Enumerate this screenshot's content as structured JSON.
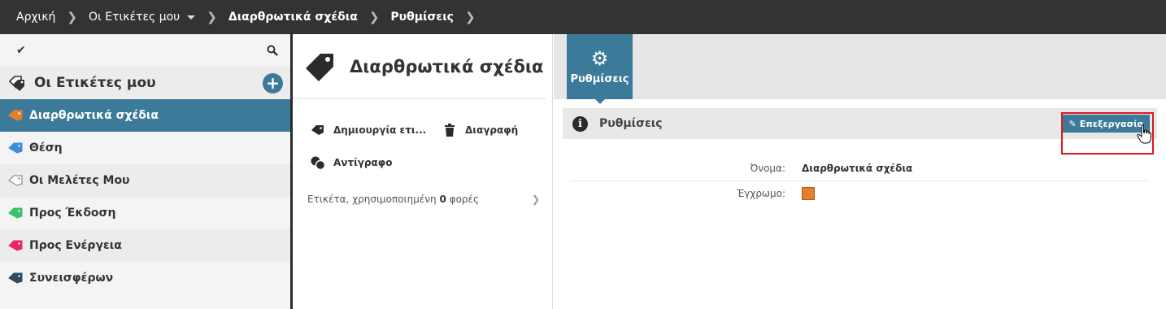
{
  "breadcrumb": {
    "items": [
      {
        "label": "Αρχική"
      },
      {
        "label": "Οι Ετικέτες μου"
      },
      {
        "label": "Διαρθρωτικά σχέδια"
      },
      {
        "label": "Ρυθμίσεις"
      }
    ]
  },
  "sidebar": {
    "title": "Οι Ετικέτες μου",
    "items": [
      {
        "label": "Διαρθρωτικά σχέδια",
        "color": "#e5802a",
        "active": true
      },
      {
        "label": "Θέση",
        "color": "#3a8fd9"
      },
      {
        "label": "Οι Μελέτες Μου",
        "color": "#ffffff"
      },
      {
        "label": "Προς Έκδοση",
        "color": "#3bbf6a"
      },
      {
        "label": "Προς Ενέργεια",
        "color": "#e8266b"
      },
      {
        "label": "Συνεισφέρων",
        "color": "#2f4a60"
      }
    ]
  },
  "middle": {
    "title": "Διαρθρωτικά σχέδια",
    "actions": {
      "create": "Δημιουργία ετι...",
      "delete": "Διαγραφή",
      "copy": "Αντίγραφο"
    },
    "usage": {
      "prefix": "Ετικέτα, χρησιμοποιημένη",
      "count": "0",
      "suffix": "φορές"
    }
  },
  "right": {
    "tab_label": "Ρυθμίσεις",
    "panel_title": "Ρυθμίσεις",
    "edit_label": "Επεξεργασία",
    "fields": {
      "name_label": "Όνομα:",
      "name_value": "Διαρθρωτικά σχέδια",
      "color_label": "Έγχρωμο:",
      "color_value": "#e5802a"
    }
  },
  "colors": {
    "accent": "#3b7a99",
    "topbar": "#333333",
    "highlight": "#e0151e"
  }
}
